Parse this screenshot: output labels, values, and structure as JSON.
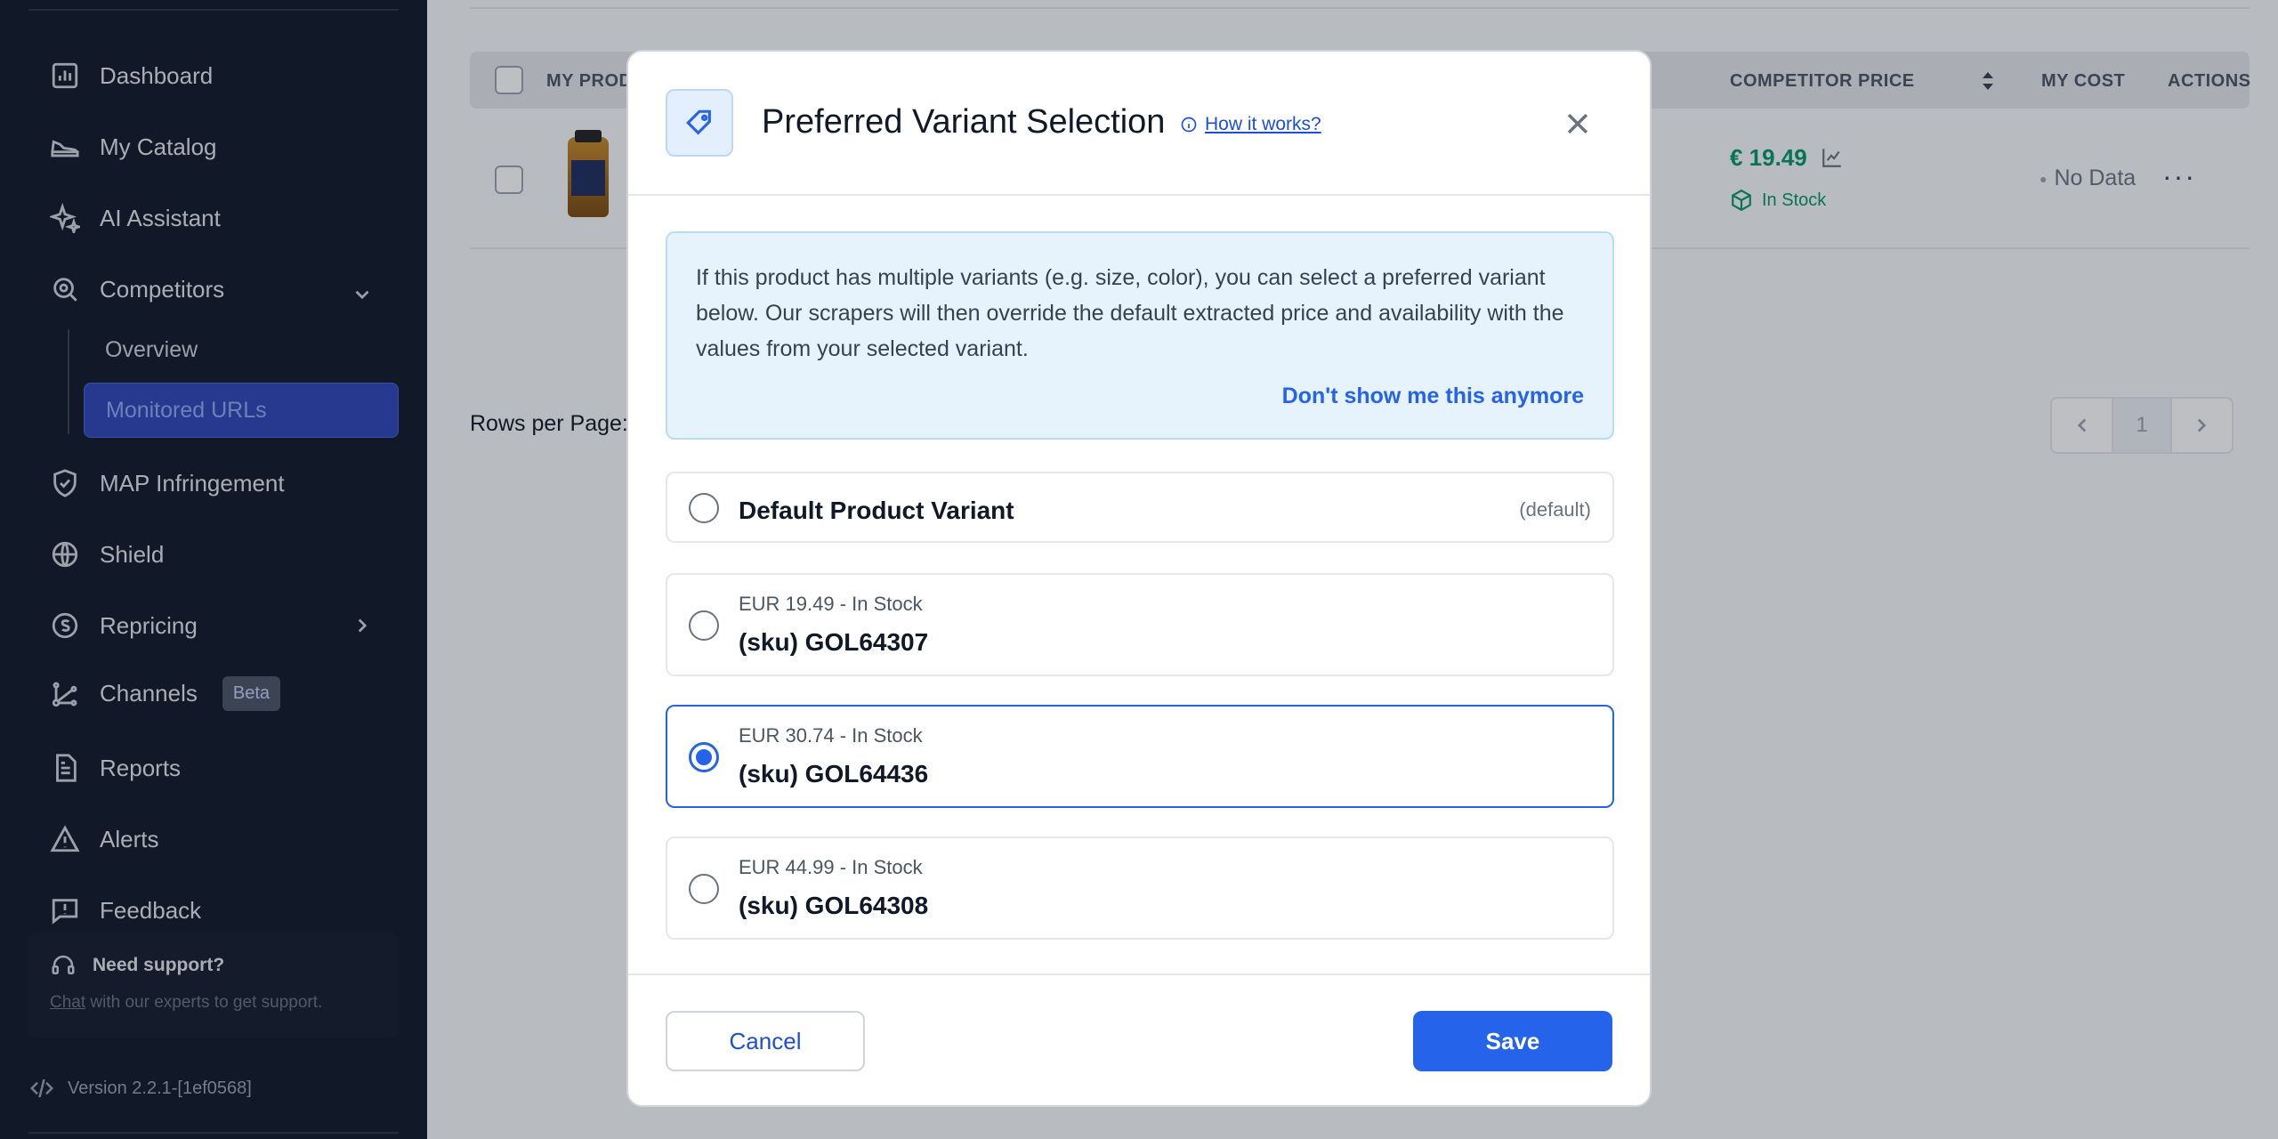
{
  "sidebar": {
    "items": [
      {
        "label": "Dashboard",
        "icon": "chart-icon"
      },
      {
        "label": "My Catalog",
        "icon": "shoe-icon"
      },
      {
        "label": "AI Assistant",
        "icon": "sparkles-icon"
      },
      {
        "label": "Competitors",
        "icon": "search-competitor-icon"
      },
      {
        "label": "MAP Infringement",
        "icon": "shield-check-icon"
      },
      {
        "label": "Shield",
        "icon": "globe-icon"
      },
      {
        "label": "Repricing",
        "icon": "coin-icon"
      },
      {
        "label": "Channels",
        "icon": "network-icon",
        "badge": "Beta"
      },
      {
        "label": "Reports",
        "icon": "document-icon"
      },
      {
        "label": "Alerts",
        "icon": "warning-icon"
      },
      {
        "label": "Feedback",
        "icon": "message-alert-icon"
      }
    ],
    "competitors_sub": [
      "Overview",
      "Monitored URLs"
    ],
    "support": {
      "title": "Need support?",
      "link": "Chat",
      "text": " with our experts to get support."
    },
    "version": "Version 2.2.1-[1ef0568]"
  },
  "table": {
    "headers": [
      "MY PROD",
      "COMPETITOR PRICE",
      "MY COST",
      "ACTIONS"
    ],
    "row": {
      "price": "€ 19.49",
      "stock": "In Stock",
      "cost": "No Data"
    },
    "rows_per_page": "Rows per Page:",
    "page": "1"
  },
  "modal": {
    "title": "Preferred Variant Selection",
    "how_link": "How it works?",
    "info": "If this product has multiple variants (e.g. size, color), you can select a preferred variant below. Our scrapers will then override the default extracted price and availability with the values from your selected variant.",
    "dismiss": "Don't show me this anymore",
    "default_option": {
      "label": "Default Product Variant",
      "tag": "(default)"
    },
    "variants": [
      {
        "meta": "EUR 19.49 - In Stock",
        "sku": "(sku) GOL64307",
        "selected": false
      },
      {
        "meta": "EUR 30.74 - In Stock",
        "sku": "(sku) GOL64436",
        "selected": true
      },
      {
        "meta": "EUR 44.99 - In Stock",
        "sku": "(sku) GOL64308",
        "selected": false
      }
    ],
    "cancel": "Cancel",
    "save": "Save"
  },
  "colors": {
    "accent": "#2563eb",
    "sidebar_bg": "#111827",
    "success": "#059669"
  }
}
